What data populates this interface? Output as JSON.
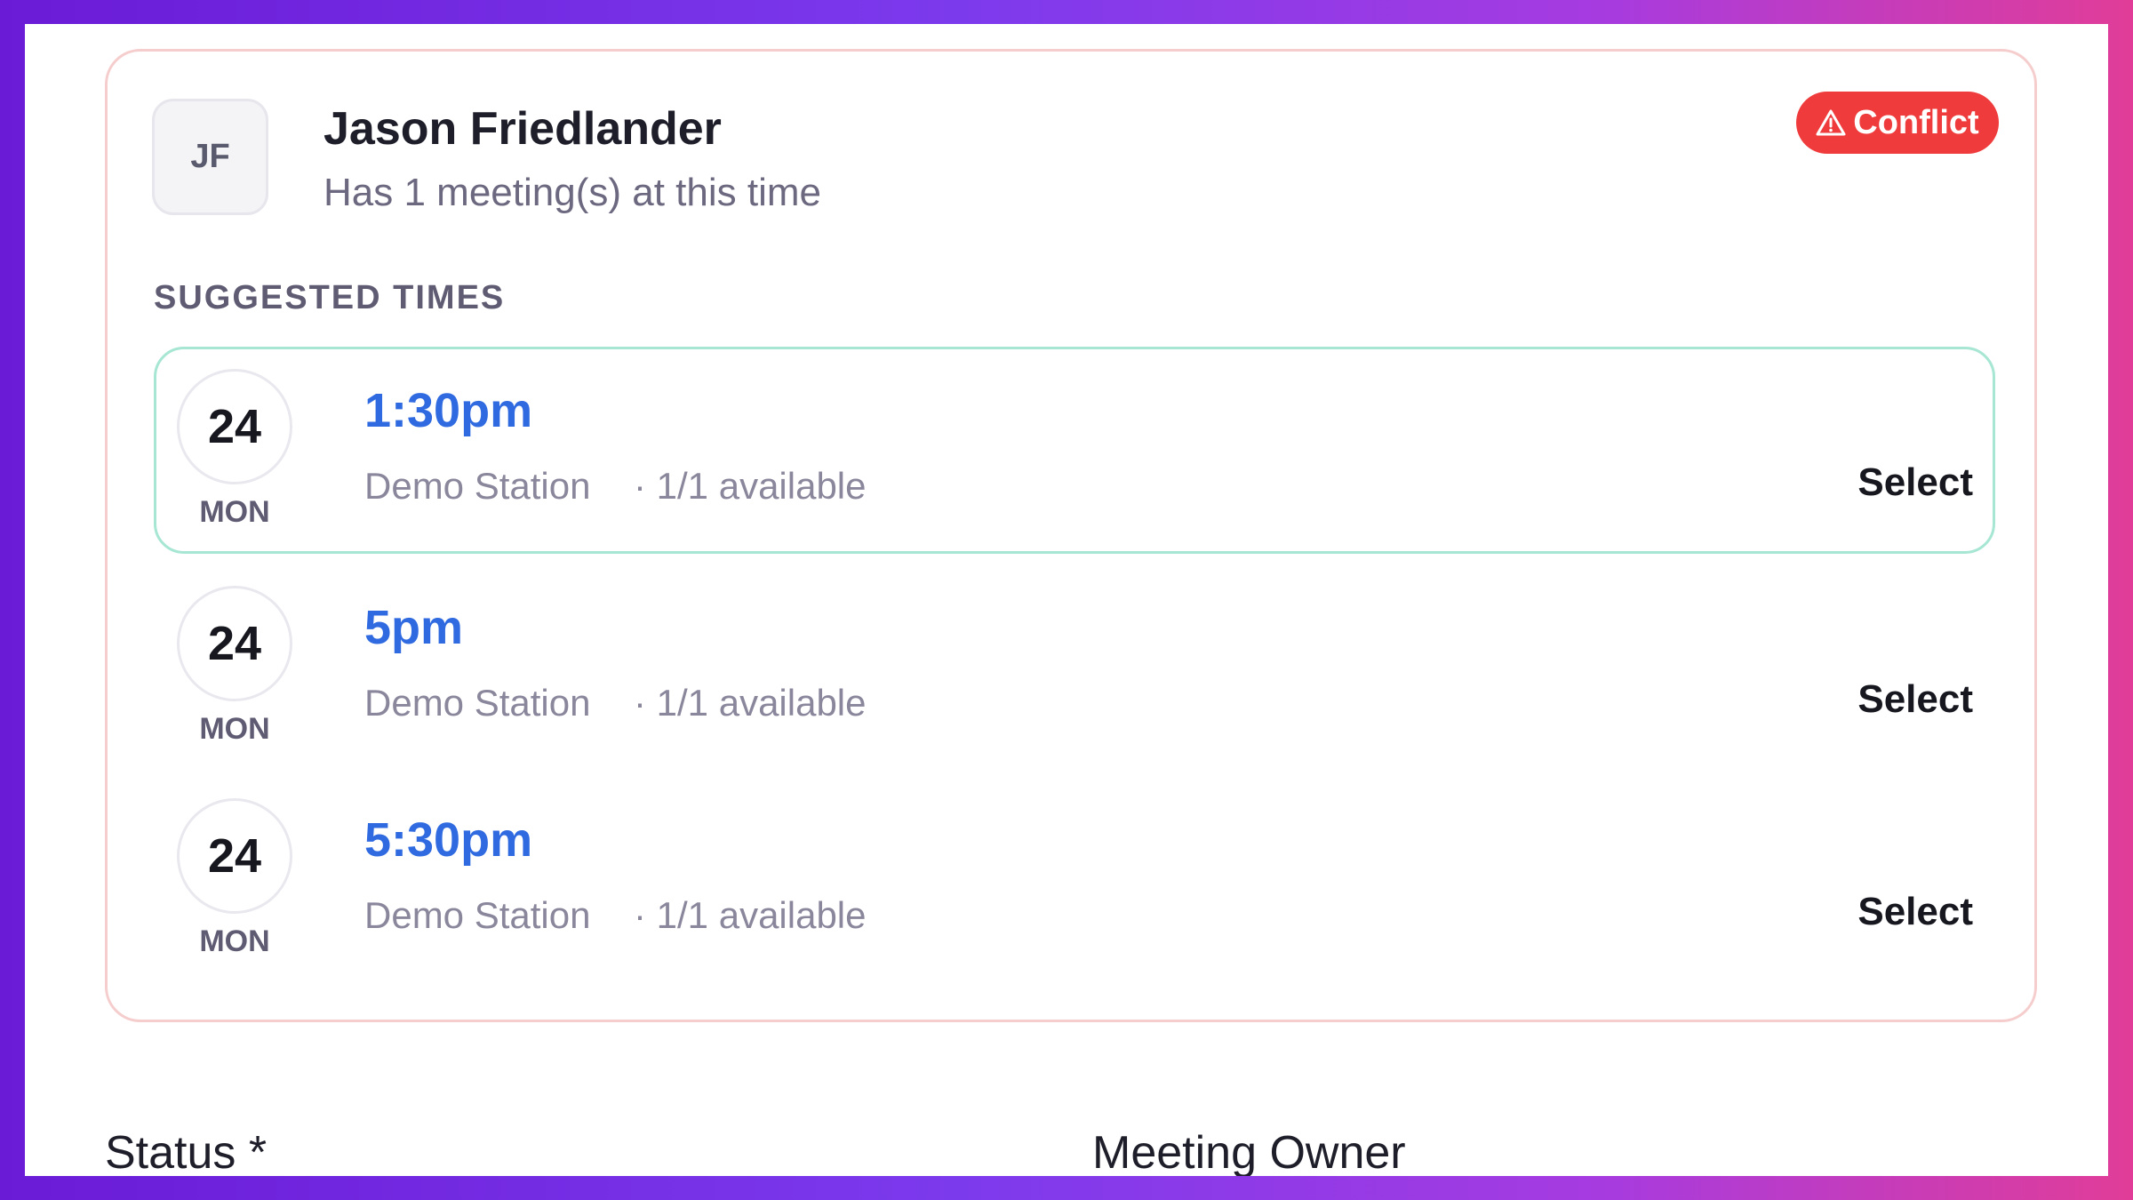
{
  "attendee": {
    "initials": "JF",
    "name": "Jason Friedlander",
    "subtext": "Has 1 meeting(s) at this time",
    "badge": "Conflict",
    "badge_color": "#ef3b3b"
  },
  "suggested": {
    "heading": "SUGGESTED TIMES",
    "slots": [
      {
        "day": "24",
        "weekday": "MON",
        "time": "1:30pm",
        "location": "Demo Station",
        "availability": "· 1/1 available",
        "action": "Select",
        "highlighted": true
      },
      {
        "day": "24",
        "weekday": "MON",
        "time": "5pm",
        "location": "Demo Station",
        "availability": "· 1/1 available",
        "action": "Select",
        "highlighted": false
      },
      {
        "day": "24",
        "weekday": "MON",
        "time": "5:30pm",
        "location": "Demo Station",
        "availability": "· 1/1 available",
        "action": "Select",
        "highlighted": false
      }
    ]
  },
  "form": {
    "status_label": "Status *",
    "owner_label": "Meeting Owner"
  },
  "colors": {
    "time_accent": "#2f6ae0",
    "selected_border": "#a6e6d3",
    "card_border": "#f6cdcd"
  },
  "icons": {
    "badge_icon": "warning-triangle-icon"
  }
}
